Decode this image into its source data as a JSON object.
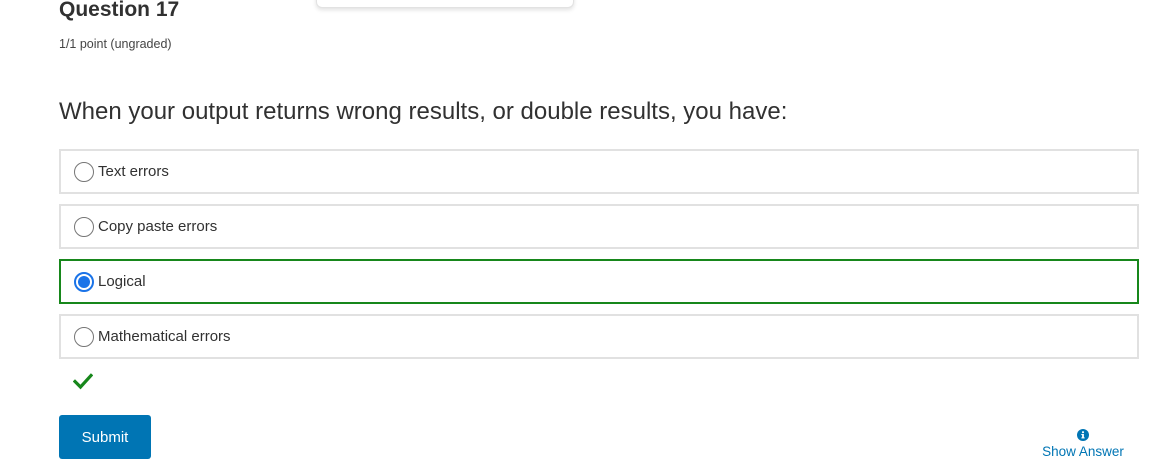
{
  "question": {
    "title": "Question 17",
    "points": "1/1 point (ungraded)",
    "prompt": "When your output returns wrong results, or double results, you have:"
  },
  "choices": [
    {
      "label": "Text errors",
      "selected": false
    },
    {
      "label": "Copy paste errors",
      "selected": false
    },
    {
      "label": "Logical",
      "selected": true
    },
    {
      "label": "Mathematical errors",
      "selected": false
    }
  ],
  "result": {
    "icon": "checkmark-icon",
    "color": "#17871b"
  },
  "actions": {
    "submit_label": "Submit",
    "show_answer_label": "Show Answer",
    "show_answer_icon": "info-icon"
  },
  "colors": {
    "primary": "#0075b4",
    "correct": "#17871b",
    "radio_selected": "#1a73e8",
    "border": "#e1e1e1"
  }
}
